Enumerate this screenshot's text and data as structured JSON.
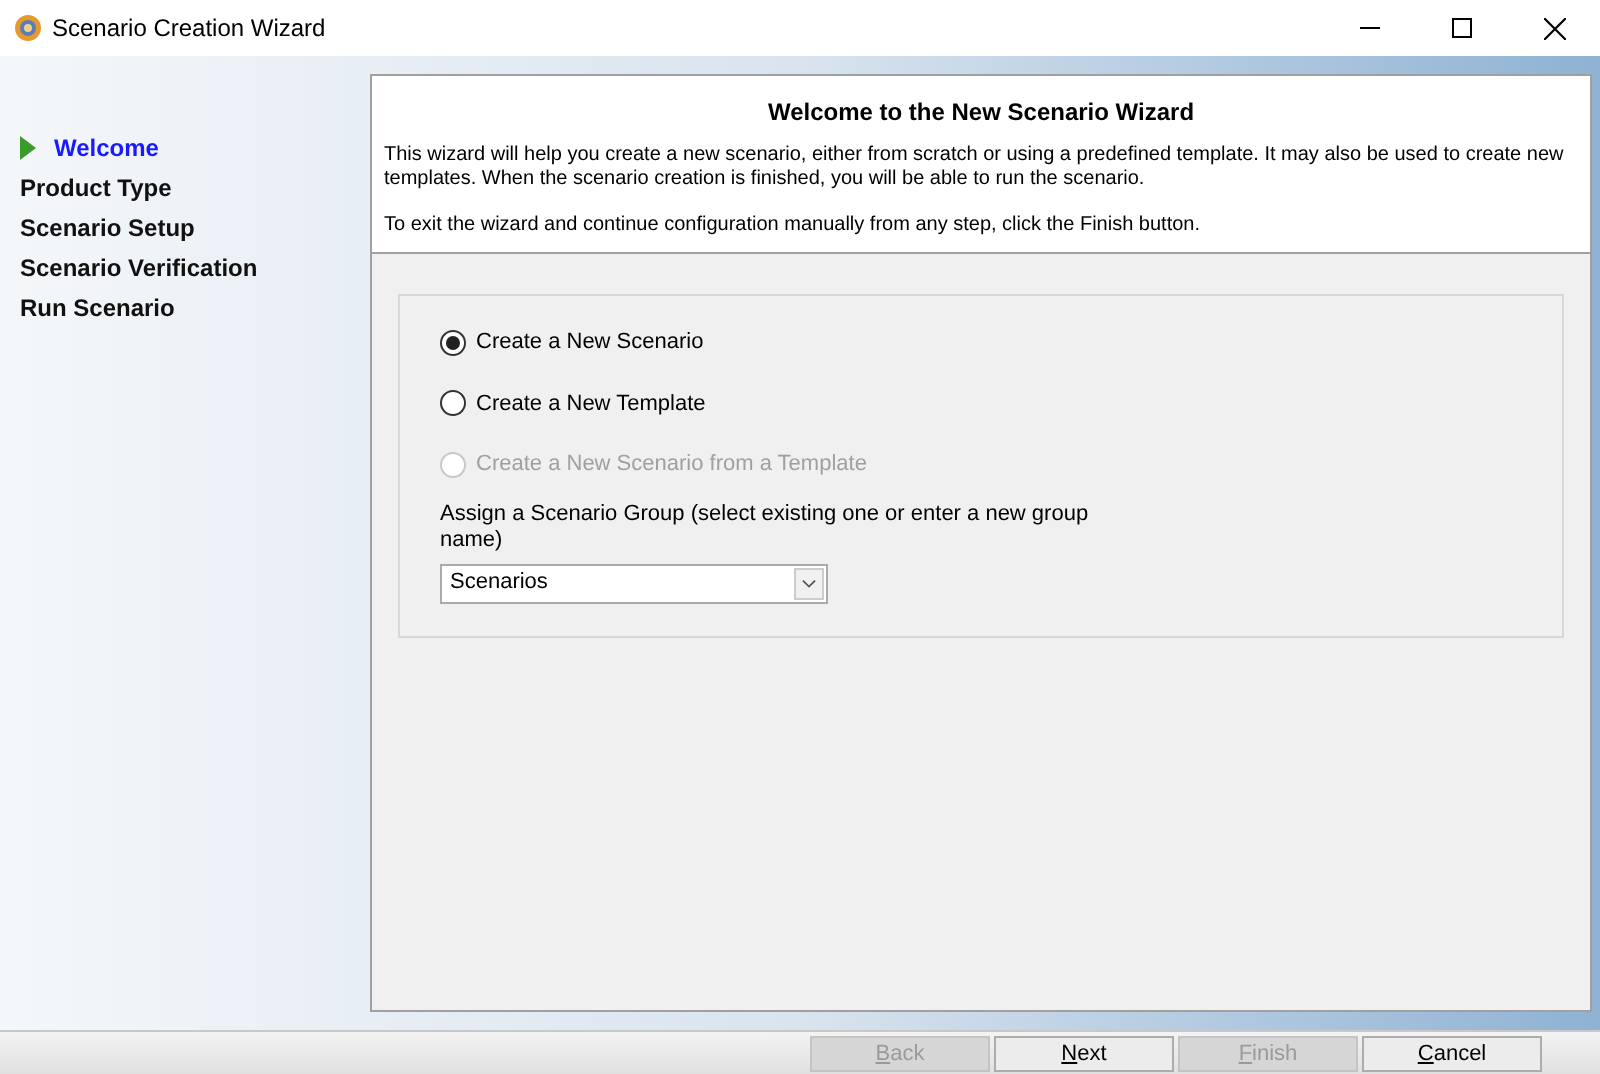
{
  "window": {
    "title": "Scenario Creation Wizard"
  },
  "steps": [
    {
      "label": "Welcome",
      "selected": true
    },
    {
      "label": "Product Type",
      "selected": false
    },
    {
      "label": "Scenario Setup",
      "selected": false
    },
    {
      "label": "Scenario Verification",
      "selected": false
    },
    {
      "label": "Run Scenario",
      "selected": false
    }
  ],
  "header": {
    "title": "Welcome to the New Scenario Wizard",
    "paragraphs": [
      "This wizard will help you create a new scenario, either from scratch or using a predefined template. It may also be used to create new templates. When the scenario creation is finished, you will be able to run the scenario.",
      "To exit the wizard and continue configuration manually from any step, click the Finish button."
    ]
  },
  "options": [
    {
      "label": "Create a New Scenario",
      "checked": true,
      "disabled": false
    },
    {
      "label": "Create a New Template",
      "checked": false,
      "disabled": false
    },
    {
      "label": "Create a New Scenario from a Template",
      "checked": false,
      "disabled": true
    }
  ],
  "group": {
    "label": "Assign a Scenario Group (select existing one or enter a new group name)",
    "value": "Scenarios"
  },
  "buttons": [
    {
      "label": "Back",
      "disabled": true
    },
    {
      "label": "Next",
      "disabled": false
    },
    {
      "label": "Finish",
      "disabled": true
    },
    {
      "label": "Cancel",
      "disabled": false
    }
  ]
}
